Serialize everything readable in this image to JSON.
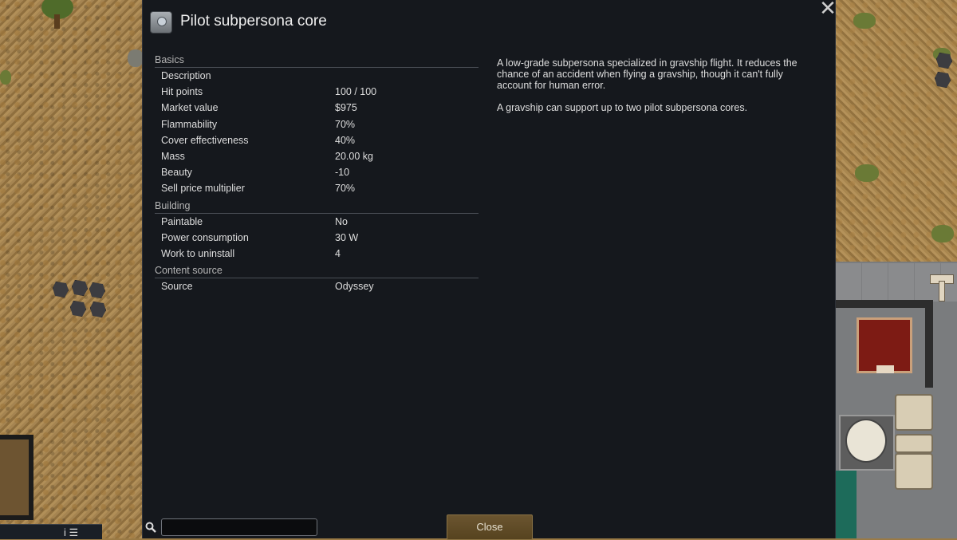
{
  "dialog": {
    "title": "Pilot subpersona core",
    "title_icon": "subpersona-core-icon",
    "close_icon": "close-x-icon"
  },
  "stats": {
    "sections": [
      {
        "header": "Basics",
        "rows": [
          {
            "label": "Description",
            "value": ""
          },
          {
            "label": "Hit points",
            "value": "100 / 100"
          },
          {
            "label": "Market value",
            "value": "$975"
          },
          {
            "label": "Flammability",
            "value": "70%"
          },
          {
            "label": "Cover effectiveness",
            "value": "40%"
          },
          {
            "label": "Mass",
            "value": "20.00 kg"
          },
          {
            "label": "Beauty",
            "value": "-10"
          },
          {
            "label": "Sell price multiplier",
            "value": "70%"
          }
        ]
      },
      {
        "header": "Building",
        "rows": [
          {
            "label": "Paintable",
            "value": "No"
          },
          {
            "label": "Power consumption",
            "value": "30 W"
          },
          {
            "label": "Work to uninstall",
            "value": "4"
          }
        ]
      },
      {
        "header": "Content source",
        "rows": [
          {
            "label": "Source",
            "value": "Odyssey"
          }
        ]
      }
    ]
  },
  "description": {
    "paragraph_1": "A low-grade subpersona specialized in gravship flight. It reduces the chance of an accident when flying a gravship, though it can't fully account for human error.",
    "paragraph_2": "A gravship can support up to two pilot subpersona cores."
  },
  "footer": {
    "search_icon": "search-icon",
    "search_value": "",
    "close_label": "Close"
  },
  "hud": {
    "icons": "i ☰"
  },
  "colors": {
    "dialog_bg": "#15181d",
    "close_button": "#5f4b27"
  }
}
